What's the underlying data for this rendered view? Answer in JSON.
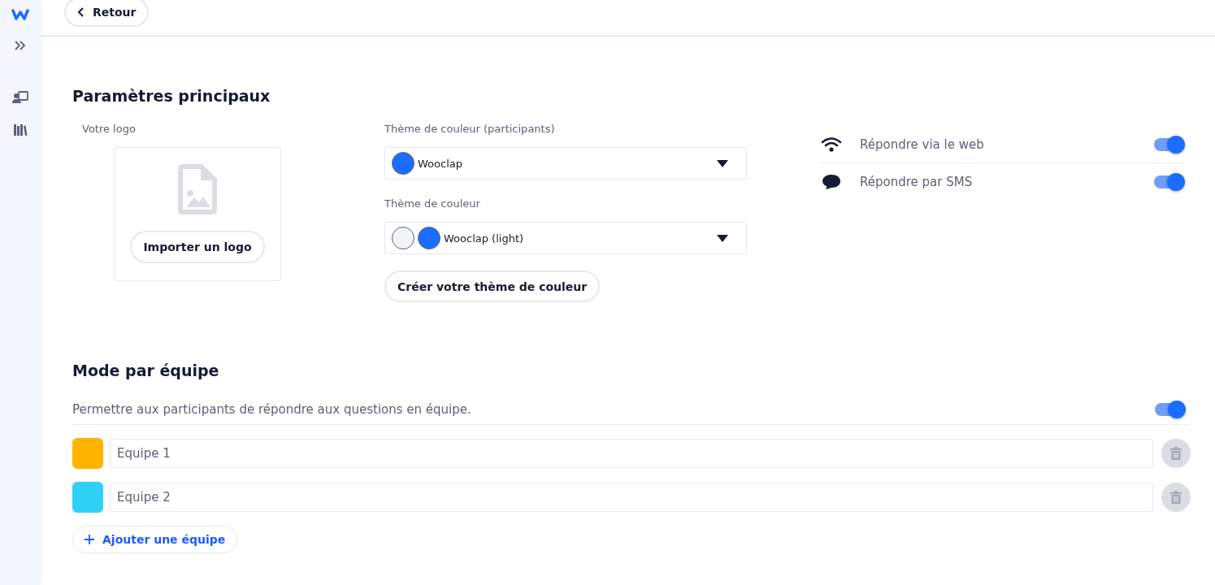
{
  "top_bar": {
    "back_button": "Retour"
  },
  "sidebar": {
    "items": [
      {
        "kind": "logo",
        "selected": false
      },
      {
        "kind": "expand",
        "selected": false
      },
      {
        "kind": "presenter",
        "selected": false
      },
      {
        "kind": "library",
        "selected": false
      }
    ]
  },
  "main_settings": {
    "title": "Paramètres principaux",
    "logo": {
      "label": "Votre logo",
      "button": "Importer un logo"
    },
    "themes": [
      {
        "label": "Thème de couleur (participants)",
        "value": "Wooclap",
        "swatches": [
          {
            "color": "#1a6dff"
          }
        ]
      },
      {
        "label": "Thème de couleur",
        "value": "Wooclap (light)",
        "swatches": [
          {
            "color": "#f3f4f8"
          },
          {
            "color": "#1a6dff"
          }
        ]
      }
    ],
    "create_theme_button": "Créer votre thème de couleur",
    "options": [
      {
        "kind": "web",
        "label": "Répondre via le web",
        "on": true
      },
      {
        "kind": "sms",
        "label": "Répondre par SMS",
        "on": true
      }
    ]
  },
  "team_mode": {
    "title": "Mode par équipe",
    "description": "Permettre aux participants de répondre aux questions en équipe.",
    "on": true,
    "teams": [
      {
        "value": "Equipe 1",
        "color": "#ffb400"
      },
      {
        "value": "Equipe 2",
        "color": "#2fd0f5"
      }
    ],
    "add_button": "Ajouter une équipe"
  }
}
